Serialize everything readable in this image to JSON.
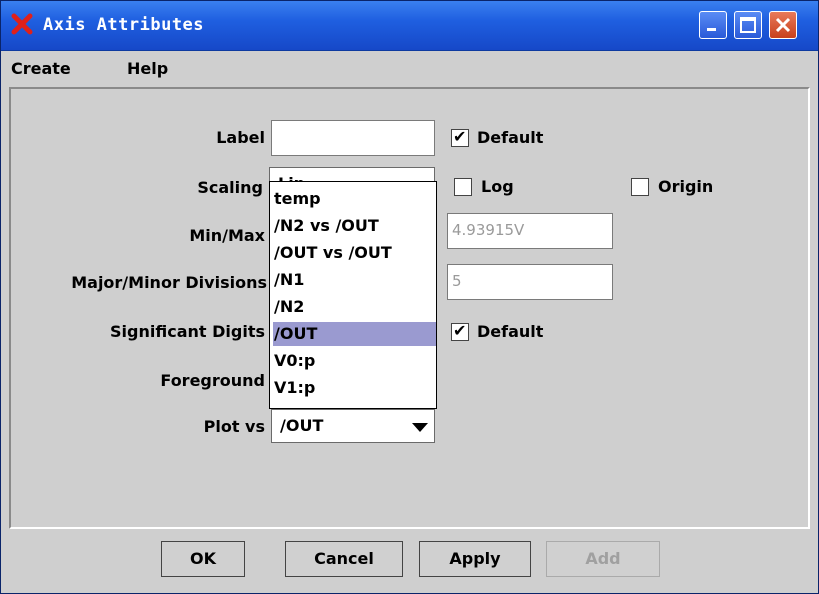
{
  "window": {
    "title": "Axis Attributes"
  },
  "menu": {
    "create": "Create",
    "help": "Help"
  },
  "form": {
    "label_label": "Label",
    "label_value": "",
    "label_default": "Default",
    "scaling_label": "Scaling",
    "scaling_value": "Lin",
    "log_label": "Log",
    "origin_label": "Origin",
    "minmax_label": "Min/Max",
    "max_value": "4.93915V",
    "divisions_label": "Major/Minor Divisions",
    "minor_value": "5",
    "sigdigits_label": "Significant Digits",
    "sigdigits_default": "Default",
    "foreground_label": "Foreground",
    "plotvs_label": "Plot vs",
    "plotvs_value": "/OUT"
  },
  "dropdown": {
    "items": [
      "temp",
      "/N2 vs /OUT",
      "/OUT vs /OUT",
      "/N1",
      "/N2",
      "/OUT",
      "V0:p",
      "V1:p"
    ],
    "selected_index": 5
  },
  "checkboxes": {
    "label_default": true,
    "log": false,
    "origin": false,
    "sigdigits_default": true
  },
  "buttons": {
    "ok": "OK",
    "cancel": "Cancel",
    "apply": "Apply",
    "add": "Add"
  },
  "icons": {
    "app": "red-x-icon",
    "minimize": "minimize-icon",
    "maximize": "maximize-icon",
    "close": "close-icon",
    "dropdown_arrow": "chevron-down-icon"
  },
  "colors": {
    "titlebar": "#1f5fe0",
    "selection": "#9a9ad0",
    "close_button": "#c8401c"
  }
}
